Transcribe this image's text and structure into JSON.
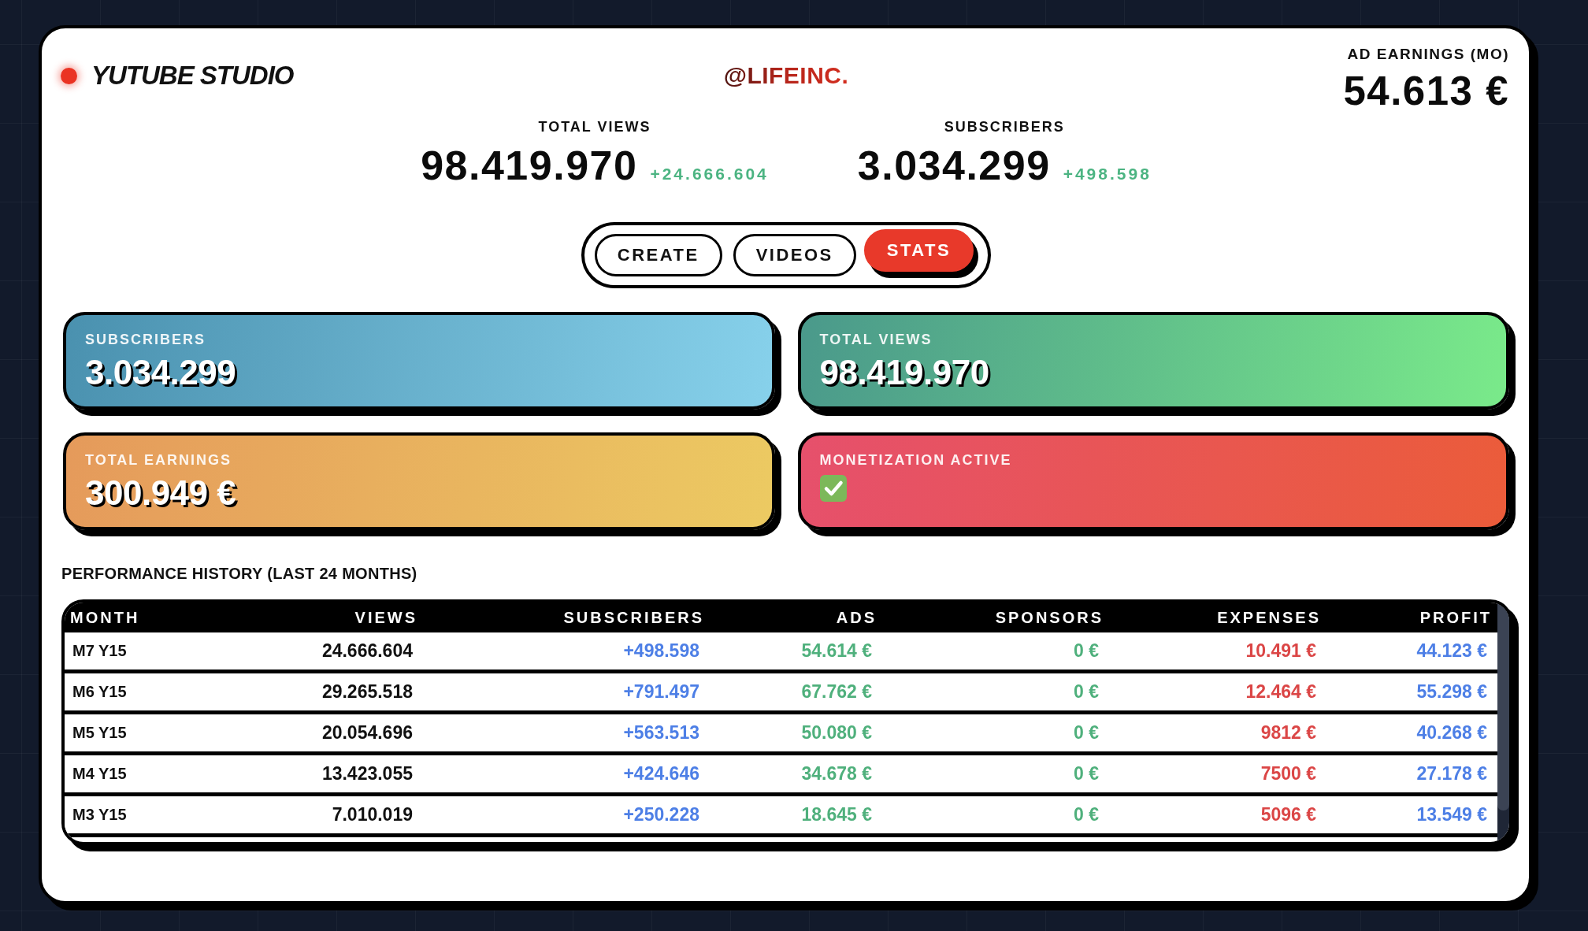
{
  "header": {
    "logo": "YUTUBE STUDIO",
    "handle": "@LIFEINC.",
    "ad_earnings": {
      "label": "AD EARNINGS (MO)",
      "value": "54.613 €"
    }
  },
  "summary_stats": [
    {
      "label": "TOTAL VIEWS",
      "value": "98.419.970",
      "delta": "+24.666.604"
    },
    {
      "label": "SUBSCRIBERS",
      "value": "3.034.299",
      "delta": "+498.598"
    }
  ],
  "tabs": [
    {
      "label": "CREATE",
      "selected": false
    },
    {
      "label": "VIDEOS",
      "selected": false
    },
    {
      "label": "STATS",
      "selected": true
    }
  ],
  "stat_cards": [
    {
      "kind": "number",
      "label": "SUBSCRIBERS",
      "value": "3.034.299"
    },
    {
      "kind": "number",
      "label": "TOTAL VIEWS",
      "value": "98.419.970"
    },
    {
      "kind": "number",
      "label": "TOTAL EARNINGS",
      "value": "300.949 €"
    },
    {
      "kind": "status",
      "label": "MONETIZATION ACTIVE",
      "active": true
    }
  ],
  "performance_history": {
    "title": "PERFORMANCE HISTORY (LAST 24 MONTHS)",
    "columns": [
      "MONTH",
      "VIEWS",
      "SUBSCRIBERS",
      "ADS",
      "SPONSORS",
      "EXPENSES",
      "PROFIT"
    ],
    "rows": [
      [
        "M7 Y15",
        "24.666.604",
        "+498.598",
        "54.614 €",
        "0 €",
        "10.491 €",
        "44.123 €"
      ],
      [
        "M6 Y15",
        "29.265.518",
        "+791.497",
        "67.762 €",
        "0 €",
        "12.464 €",
        "55.298 €"
      ],
      [
        "M5 Y15",
        "20.054.696",
        "+563.513",
        "50.080 €",
        "0 €",
        "9812 €",
        "40.268 €"
      ],
      [
        "M4 Y15",
        "13.423.055",
        "+424.646",
        "34.678 €",
        "0 €",
        "7500 €",
        "27.178 €"
      ],
      [
        "M3 Y15",
        "7.010.019",
        "+250.228",
        "18.645 €",
        "0 €",
        "5096 €",
        "13.549 €"
      ]
    ]
  }
}
